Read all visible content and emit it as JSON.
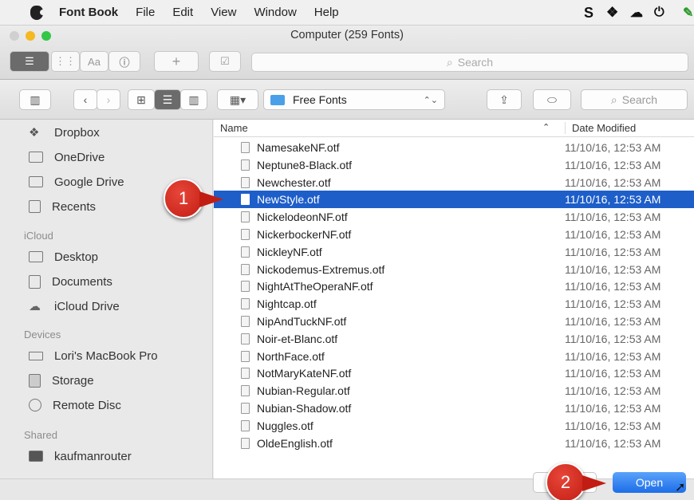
{
  "menubar": {
    "app": "Font Book",
    "items": [
      "File",
      "Edit",
      "View",
      "Window",
      "Help"
    ]
  },
  "fontbook": {
    "title": "Computer (259 Fonts)",
    "search_placeholder": "Search",
    "view_label": "Aa"
  },
  "dialog": {
    "location": "Free Fonts",
    "search_placeholder": "Search",
    "sidebar": {
      "favorites": [
        {
          "label": "Dropbox",
          "icon": "dropbox-icon"
        },
        {
          "label": "OneDrive",
          "icon": "folder-icon"
        },
        {
          "label": "Google Drive",
          "icon": "folder-icon"
        },
        {
          "label": "Recents",
          "icon": "recents-icon"
        }
      ],
      "icloud_header": "iCloud",
      "icloud": [
        {
          "label": "Desktop",
          "icon": "desktop-icon"
        },
        {
          "label": "Documents",
          "icon": "documents-icon"
        },
        {
          "label": "iCloud Drive",
          "icon": "cloud-icon"
        }
      ],
      "devices_header": "Devices",
      "devices": [
        {
          "label": "Lori's MacBook Pro",
          "icon": "laptop-icon"
        },
        {
          "label": "Storage",
          "icon": "disk-icon"
        },
        {
          "label": "Remote Disc",
          "icon": "disc-icon"
        }
      ],
      "shared_header": "Shared",
      "shared": [
        {
          "label": "kaufmanrouter",
          "icon": "display-icon"
        }
      ]
    },
    "columns": {
      "name": "Name",
      "date": "Date Modified"
    },
    "files": [
      {
        "name": "NamesakeNF.otf",
        "date": "11/10/16, 12:53 AM"
      },
      {
        "name": "Neptune8-Black.otf",
        "date": "11/10/16, 12:53 AM"
      },
      {
        "name": "Newchester.otf",
        "date": "11/10/16, 12:53 AM"
      },
      {
        "name": "NewStyle.otf",
        "date": "11/10/16, 12:53 AM",
        "selected": true
      },
      {
        "name": "NickelodeonNF.otf",
        "date": "11/10/16, 12:53 AM"
      },
      {
        "name": "NickerbockerNF.otf",
        "date": "11/10/16, 12:53 AM"
      },
      {
        "name": "NickleyNF.otf",
        "date": "11/10/16, 12:53 AM"
      },
      {
        "name": "Nickodemus-Extremus.otf",
        "date": "11/10/16, 12:53 AM"
      },
      {
        "name": "NightAtTheOperaNF.otf",
        "date": "11/10/16, 12:53 AM"
      },
      {
        "name": "Nightcap.otf",
        "date": "11/10/16, 12:53 AM"
      },
      {
        "name": "NipAndTuckNF.otf",
        "date": "11/10/16, 12:53 AM"
      },
      {
        "name": "Noir-et-Blanc.otf",
        "date": "11/10/16, 12:53 AM"
      },
      {
        "name": "NorthFace.otf",
        "date": "11/10/16, 12:53 AM"
      },
      {
        "name": "NotMaryKateNF.otf",
        "date": "11/10/16, 12:53 AM"
      },
      {
        "name": "Nubian-Regular.otf",
        "date": "11/10/16, 12:53 AM"
      },
      {
        "name": "Nubian-Shadow.otf",
        "date": "11/10/16, 12:53 AM"
      },
      {
        "name": "Nuggles.otf",
        "date": "11/10/16, 12:53 AM"
      },
      {
        "name": "OldeEnglish.otf",
        "date": "11/10/16, 12:53 AM"
      }
    ],
    "open_label": "Open"
  },
  "callouts": {
    "one": "1",
    "two": "2"
  },
  "colors": {
    "selection": "#1e5ec9",
    "callout": "#d9281c",
    "open_button": "#2a7ef2"
  }
}
